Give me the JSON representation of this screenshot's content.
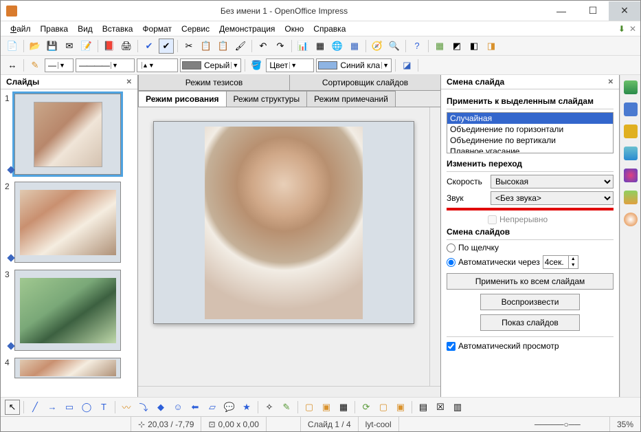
{
  "window": {
    "title": "Без имени 1 - OpenOffice Impress"
  },
  "menu": {
    "file": "Файл",
    "edit": "Правка",
    "view": "Вид",
    "insert": "Вставка",
    "format": "Формат",
    "tools": "Сервис",
    "slideshow": "Демонстрация",
    "window": "Окно",
    "help": "Справка"
  },
  "toolbar2": {
    "gray": "Серый",
    "color_label": "Цвет",
    "blue": "Синий кла"
  },
  "slides_panel": {
    "title": "Слайды"
  },
  "tabs": {
    "outline_top": "Режим тезисов",
    "sorter": "Сортировщик слайдов",
    "drawing": "Режим рисования",
    "structure": "Режим структуры",
    "notes": "Режим примечаний"
  },
  "task": {
    "title": "Смена слайда",
    "apply_label": "Применить к выделенным слайдам",
    "effects": [
      "Случайная",
      "Объединение по горизонтали",
      "Объединение по вертикали",
      "Плавное угасание"
    ],
    "modify_label": "Изменить переход",
    "speed_label": "Скорость",
    "speed_value": "Высокая",
    "sound_label": "Звук",
    "sound_value": "<Без звука>",
    "loop": "Непрерывно",
    "advance_label": "Смена слайдов",
    "on_click": "По щелчку",
    "auto_after": "Автоматически через",
    "auto_value": "4сек.",
    "apply_all": "Применить ко всем слайдам",
    "play": "Воспроизвести",
    "show": "Показ слайдов",
    "auto_preview": "Автоматический просмотр"
  },
  "status": {
    "coords": "20,03 / -7,79",
    "size": "0,00 x 0,00",
    "slide": "Слайд 1 / 4",
    "layout": "lyt-cool",
    "zoom": "35%"
  },
  "slides": [
    {
      "n": "1"
    },
    {
      "n": "2"
    },
    {
      "n": "3"
    },
    {
      "n": "4"
    }
  ]
}
